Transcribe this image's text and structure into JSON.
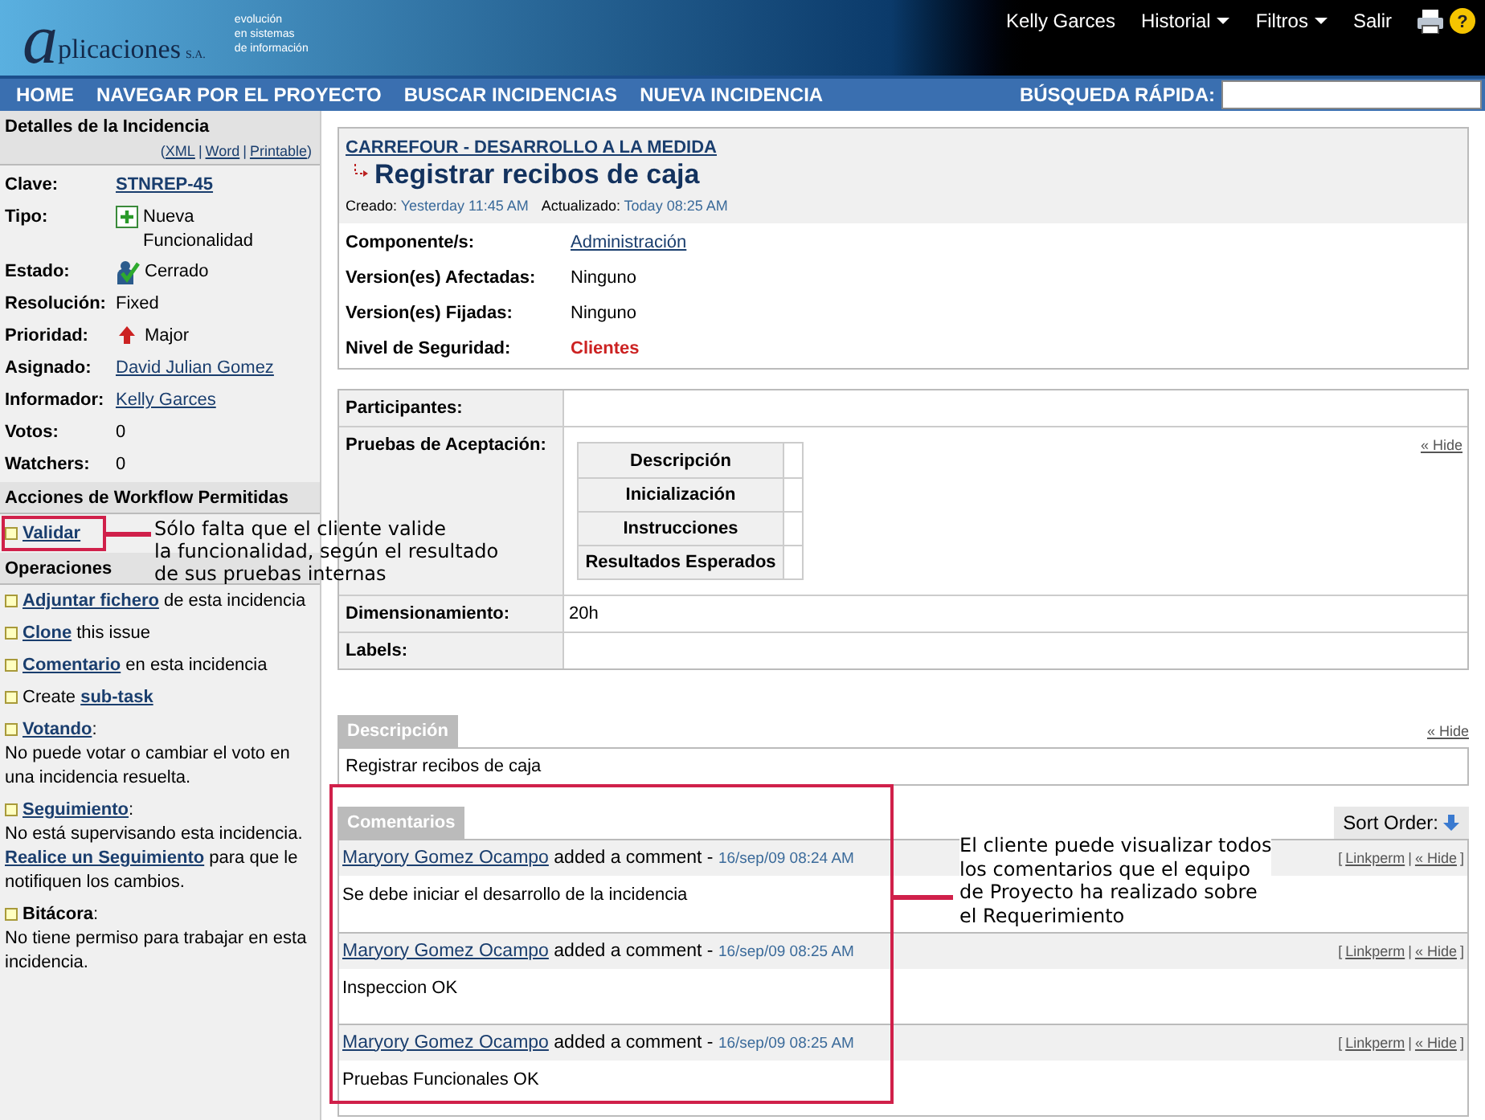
{
  "header": {
    "logo": {
      "letter": "a",
      "name": "plicaciones",
      "suffix": "S.A.",
      "tagline": [
        "evolución",
        "en sistemas",
        "de información"
      ]
    },
    "help_label": "?",
    "user_menu": [
      {
        "label": "Kelly Garces",
        "kind": "link"
      },
      {
        "label": "Historial",
        "kind": "dropdown"
      },
      {
        "label": "Filtros",
        "kind": "dropdown"
      },
      {
        "label": "Salir",
        "kind": "link"
      }
    ]
  },
  "nav": {
    "items": [
      "HOME",
      "NAVEGAR POR EL PROYECTO",
      "BUSCAR INCIDENCIAS",
      "NUEVA INCIDENCIA"
    ],
    "quick_search": {
      "label": "BÚSQUEDA RÁPIDA:"
    }
  },
  "sidebar": {
    "details": {
      "title": "Detalles de la Incidencia",
      "formats": [
        "XML",
        "Word",
        "Printable"
      ],
      "format_open": "(",
      "format_close": ")",
      "format_separator": "|",
      "fields": [
        {
          "label": "Clave:",
          "value": "STNREP-45",
          "kind": "key"
        },
        {
          "label": "Tipo:",
          "value": "Nueva Funcionalidad",
          "kind": "type"
        },
        {
          "label": "Estado:",
          "value": "Cerrado",
          "kind": "status"
        },
        {
          "label": "Resolución:",
          "value": "Fixed",
          "kind": "text"
        },
        {
          "label": "Prioridad:",
          "value": "Major",
          "kind": "priority"
        },
        {
          "label": "Asignado:",
          "value": "David Julian Gomez",
          "kind": "user"
        },
        {
          "label": "Informador:",
          "value": "Kelly Garces",
          "kind": "user"
        },
        {
          "label": "Votos:",
          "value": "0",
          "kind": "text"
        },
        {
          "label": "Watchers:",
          "value": "0",
          "kind": "text"
        }
      ]
    },
    "workflow": {
      "title": "Acciones de Workflow Permitidas",
      "actions": [
        "Validar"
      ]
    },
    "operations": {
      "title": "Operaciones",
      "items": [
        {
          "line": [
            {
              "text": "Adjuntar fichero",
              "kind": "link"
            },
            {
              "text": " de esta incidencia",
              "kind": "text"
            }
          ]
        },
        {
          "line": [
            {
              "text": "Clone",
              "kind": "link"
            },
            {
              "text": " this issue",
              "kind": "text"
            }
          ]
        },
        {
          "line": [
            {
              "text": "Comentario",
              "kind": "link"
            },
            {
              "text": " en esta incidencia",
              "kind": "text"
            }
          ]
        },
        {
          "line": [
            {
              "text": "Create ",
              "kind": "text"
            },
            {
              "text": "sub-task",
              "kind": "link"
            }
          ]
        },
        {
          "line": [
            {
              "text": "Votando",
              "kind": "link"
            },
            {
              "text": ":",
              "kind": "text"
            }
          ],
          "note": [
            {
              "text": "No puede votar o cambiar el voto en una incidencia resuelta.",
              "kind": "text"
            }
          ]
        },
        {
          "line": [
            {
              "text": "Seguimiento",
              "kind": "link"
            },
            {
              "text": ":",
              "kind": "text"
            }
          ],
          "note": [
            {
              "text": "No está supervisando esta incidencia. ",
              "kind": "text"
            },
            {
              "text": "Realice un Seguimiento",
              "kind": "link"
            },
            {
              "text": " para que le notifiquen los cambios.",
              "kind": "text"
            }
          ]
        },
        {
          "line": [
            {
              "text": "Bitácora",
              "kind": "bold"
            },
            {
              "text": ":",
              "kind": "text"
            }
          ],
          "note": [
            {
              "text": "No tiene permiso para trabajar en esta incidencia.",
              "kind": "text"
            }
          ]
        }
      ]
    }
  },
  "issue": {
    "project": "CARREFOUR - DESARROLLO A LA MEDIDA",
    "title": "Registrar recibos de caja",
    "created_label": "Creado:",
    "created": "Yesterday 11:45 AM",
    "updated_label": "Actualizado:",
    "updated": "Today 08:25 AM",
    "fields": [
      {
        "label": "Componente/s:",
        "value": "Administración",
        "kind": "link"
      },
      {
        "label": "Version(es) Afectadas:",
        "value": "Ninguno",
        "kind": "text"
      },
      {
        "label": "Version(es) Fijadas:",
        "value": "Ninguno",
        "kind": "text"
      },
      {
        "label": "Nivel de Seguridad:",
        "value": "Clientes",
        "kind": "security"
      }
    ]
  },
  "custom_fields": [
    {
      "label": "Participantes:",
      "kind": "empty"
    },
    {
      "label": "Pruebas de Aceptación:",
      "kind": "subtable",
      "hide": "« Hide",
      "rows": [
        "Descripción",
        "Inicialización",
        "Instrucciones",
        "Resultados Esperados"
      ]
    },
    {
      "label": "Dimensionamiento:",
      "kind": "text",
      "value": "20h"
    },
    {
      "label": "Labels:",
      "kind": "empty"
    }
  ],
  "description": {
    "tab": "Descripción",
    "hide": "« Hide",
    "text": "Registrar recibos de caja"
  },
  "comments": {
    "tab": "Comentarios",
    "sort_label": "Sort Order:",
    "link_open": "[",
    "link_close": "]",
    "link_separator": "|",
    "items": [
      {
        "author": "Maryory Gomez Ocampo",
        "action": "added a comment -",
        "date": "16/sep/09 08:24 AM",
        "links": [
          "Linkperm",
          "« Hide"
        ],
        "body": "Se debe iniciar el desarrollo de la incidencia"
      },
      {
        "author": "Maryory Gomez Ocampo",
        "action": "added a comment -",
        "date": "16/sep/09 08:25 AM",
        "links": [
          "Linkperm",
          "« Hide"
        ],
        "body": "Inspeccion OK"
      },
      {
        "author": "Maryory Gomez Ocampo",
        "action": "added a comment -",
        "date": "16/sep/09 08:25 AM",
        "links": [
          "Linkperm",
          "« Hide"
        ],
        "body": "Pruebas Funcionales OK"
      }
    ]
  },
  "annotations": [
    "Sólo falta que el cliente valide\nla funcionalidad, según el resultado\nde sus pruebas internas",
    "El cliente puede visualizar todos\nlos comentarios que el equipo\nde Proyecto ha realizado sobre\nel Requerimiento"
  ]
}
